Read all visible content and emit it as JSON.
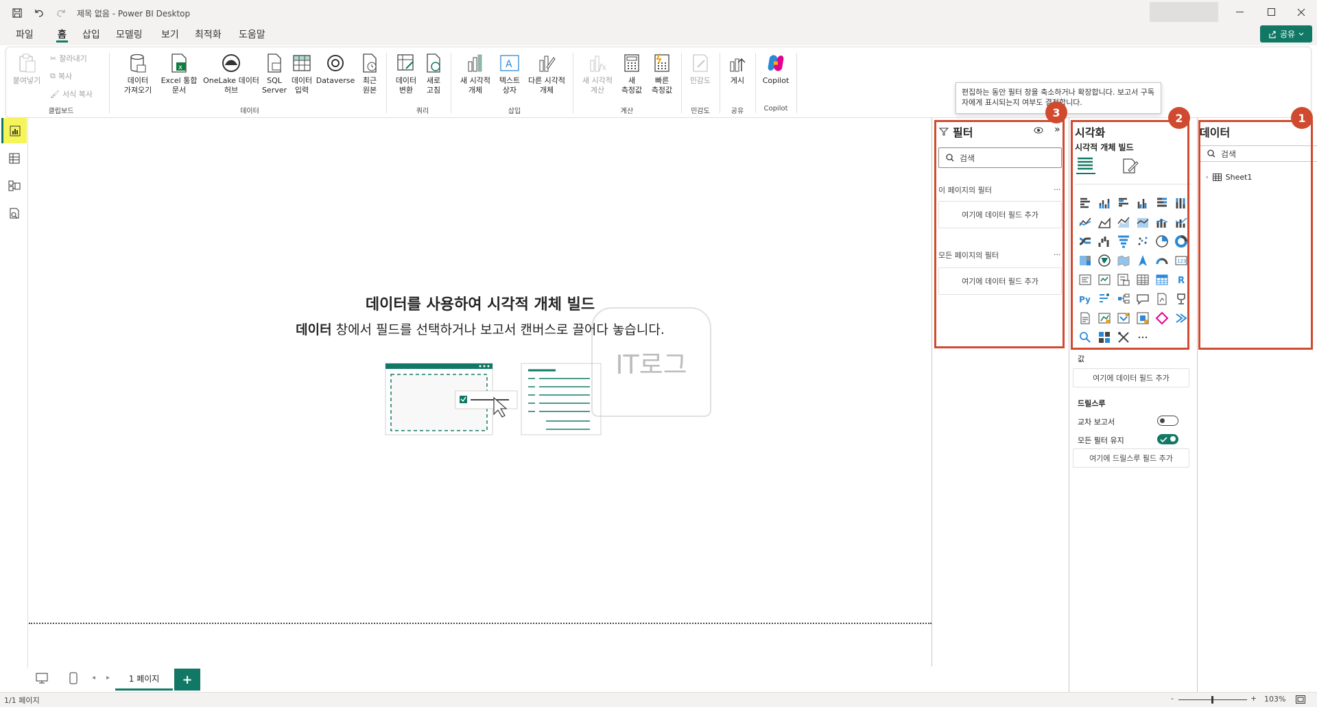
{
  "titlebar": {
    "title": "제목 없음 - Power BI Desktop"
  },
  "menu": {
    "tabs": [
      "파일",
      "홈",
      "삽입",
      "모델링",
      "보기",
      "최적화",
      "도움말"
    ],
    "active": "홈",
    "share_label": "공유"
  },
  "ribbon": {
    "clipboard": {
      "paste": "붙여넣기",
      "cut": "잘라내기",
      "copy": "복사",
      "format_painter": "서식 복사",
      "group": "클립보드"
    },
    "data": {
      "get_data": "데이터\n가져오기",
      "excel": "Excel 통합\n문서",
      "onelake": "OneLake 데이터\n허브",
      "sql": "SQL\nServer",
      "enter_data": "데이터\n입력",
      "dataverse": "Dataverse",
      "recent": "최근\n원본",
      "group": "데이터"
    },
    "queries": {
      "transform": "데이터\n변환",
      "refresh": "새로\n고침",
      "group": "쿼리"
    },
    "insert": {
      "new_visual": "새 시각적\n개체",
      "text_box": "텍스트\n상자",
      "more_visuals": "다른 시각적\n개체",
      "group": "삽입"
    },
    "calculations": {
      "new_calc": "새 시각적\n계산",
      "new_measure": "새\n측정값",
      "quick_measure": "빠른\n측정값",
      "group": "계산"
    },
    "sensitivity": {
      "label": "민감도",
      "group": "민감도"
    },
    "share": {
      "publish": "게시",
      "group": "공유"
    },
    "copilot": {
      "label": "Copilot",
      "group": "Copilot"
    }
  },
  "tooltip": {
    "text": "편집하는 동안 필터 창을 축소하거나 확장합니다. 보고서 구독자에게 표시되는지 여부도 결정합니다."
  },
  "canvas": {
    "title": "데이터를 사용하여 시각적 개체 빌드",
    "sub_bold": "데이터",
    "sub_rest": " 창에서 필드를 선택하거나 보고서 캔버스로 끌어다 놓습니다.",
    "watermark": "IT로그"
  },
  "filters": {
    "title": "필터",
    "search_placeholder": "검색",
    "page_filters": "이 페이지의 필터",
    "all_filters": "모든 페이지의 필터",
    "add_field": "여기에 데이터 필드 추가",
    "more": "...",
    "badge": "3"
  },
  "visualizations": {
    "title": "시각화",
    "build": "시각적 개체 빌드",
    "values": "값",
    "add_field": "여기에 데이터 필드 추가",
    "drillthrough": "드릴스루",
    "cross_report": "교차 보고서",
    "keep_filters": "모든 필터 유지",
    "add_drill": "여기에 드릴스루 필드 추가",
    "badge": "2",
    "icons": [
      "stacked-bar-icon",
      "stacked-column-icon",
      "clustered-bar-icon",
      "clustered-column-icon",
      "100-bar-icon",
      "100-column-icon",
      "line-chart-icon",
      "area-chart-icon",
      "stacked-area-icon",
      "100-area-icon",
      "line-stacked-column-icon",
      "line-clustered-column-icon",
      "ribbon-chart-icon",
      "waterfall-icon",
      "funnel-icon",
      "scatter-icon",
      "pie-icon",
      "donut-icon",
      "treemap-icon",
      "map-icon",
      "filled-map-icon",
      "azure-map-icon",
      "gauge-icon",
      "card-icon",
      "multirow-card-icon",
      "kpi-icon",
      "slicer-icon",
      "table-icon",
      "matrix-icon",
      "r-visual-icon",
      "python-icon",
      "key-influencers-icon",
      "decomposition-tree-icon",
      "qa-icon",
      "narrative-icon",
      "metrics-icon",
      "paginated-icon",
      "power-apps-icon",
      "power-automate-icon",
      "arcgis-icon",
      "diamond-icon",
      "chevron-icon",
      "search-visual-icon",
      "app-icon",
      "tools-icon",
      "more-icon"
    ]
  },
  "data": {
    "title": "데이터",
    "search_placeholder": "검색",
    "table": "Sheet1",
    "badge": "1"
  },
  "pages": {
    "tab": "1 페이지",
    "add": "+"
  },
  "status": {
    "page": "1/1 페이지",
    "zoom": "103%",
    "minus": "-",
    "plus": "+"
  },
  "colors": {
    "accent": "#117865",
    "highlight": "#d04a2f",
    "nav_active": "#f5f55a"
  }
}
